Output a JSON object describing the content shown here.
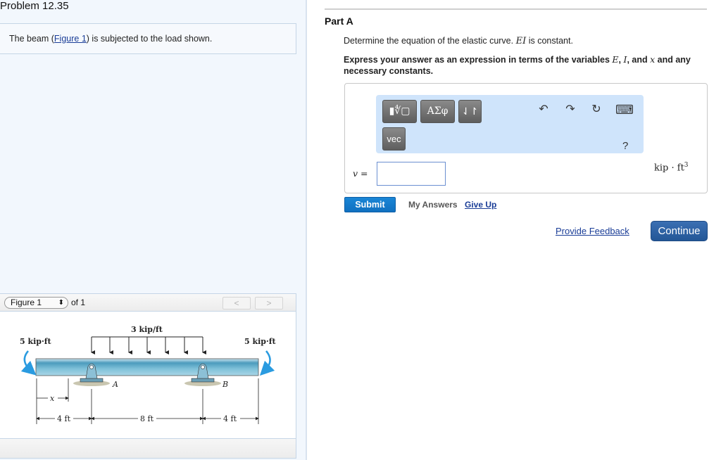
{
  "problem": {
    "title": "Problem 12.35",
    "intro_before": "The beam (",
    "intro_link": "Figure 1",
    "intro_after": ") is subjected to the load shown."
  },
  "figure_panel": {
    "selected": "Figure 1",
    "of_label": "of 1",
    "prev_icon": "chevron-left-icon",
    "next_icon": "chevron-right-icon",
    "prev_glyph": "<",
    "next_glyph": ">",
    "labels": {
      "distributed_load": "3 kip/ft",
      "left_moment": "5 kip·ft",
      "right_moment": "5 kip·ft",
      "support_a": "A",
      "support_b": "B",
      "x_var": "x",
      "dim_left": "4 ft",
      "dim_middle": "8 ft",
      "dim_right": "4 ft"
    }
  },
  "part": {
    "title": "Part A",
    "question_before": "Determine the equation of the elastic curve. ",
    "question_var": "EI",
    "question_after": " is constant.",
    "instr_1": "Express your answer as an expression in terms of the variables ",
    "instr_E": "E",
    "instr_sep1": ", ",
    "instr_I": "I",
    "instr_sep2": ", and ",
    "instr_x": "x",
    "instr_2": " and any necessary constants."
  },
  "palette": {
    "templates_label": "▮∜▢",
    "greek_label": "ΑΣφ",
    "arrows_label": "⇃↾",
    "vec_label": "vec",
    "undo_glyph": "↶",
    "redo_glyph": "↷",
    "reset_glyph": "↻",
    "keyboard_glyph": "⌨",
    "help_label": "?"
  },
  "answer": {
    "variable_label": "v =",
    "value": "",
    "units": "kip · ft",
    "units_exp": "3"
  },
  "actions": {
    "submit": "Submit",
    "my_answers": "My Answers",
    "give_up": "Give Up",
    "provide_feedback": "Provide Feedback",
    "continue": "Continue"
  },
  "colors": {
    "submit_blue": "#1a7fd0",
    "continue_blue": "#2d63a6",
    "link_blue": "#1a3d97",
    "palette_bg": "#cfe4fb",
    "beam_blue": "#7fc1d9"
  }
}
